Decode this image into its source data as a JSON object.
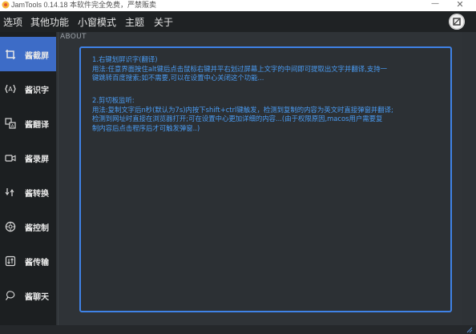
{
  "window": {
    "title": "JamTools 0.14.18 本软件完全免费，严禁贩卖",
    "minimize_glyph": "—",
    "close_glyph": "✕"
  },
  "menu": [
    "选项",
    "其他功能",
    "小窗模式",
    "主题",
    "关于"
  ],
  "sidebar": {
    "items": [
      {
        "label": "酱截屏",
        "icon": "crop-icon",
        "active": true
      },
      {
        "label": "酱识字",
        "icon": "text-recognition-icon",
        "active": false
      },
      {
        "label": "酱翻译",
        "icon": "translate-icon",
        "active": false
      },
      {
        "label": "酱录屏",
        "icon": "video-record-icon",
        "active": false
      },
      {
        "label": "酱转换",
        "icon": "convert-icon",
        "active": false
      },
      {
        "label": "酱控制",
        "icon": "control-icon",
        "active": false
      },
      {
        "label": "酱传输",
        "icon": "transfer-icon",
        "active": false
      },
      {
        "label": "酱聊天",
        "icon": "chat-icon",
        "active": false
      }
    ]
  },
  "about": {
    "section_title": "ABOUT",
    "paragraph1": [
      "1.右键划屏识字(翻译)",
      "    用法:任意界面按住alt键后点击鼠标右键并平右划过屏幕上文字的中间即可提取出文字并翻译,支持一",
      "键跳转百度搜索;如不需要,可以在设置中心关闭这个功能..."
    ],
    "paragraph2": [
      "2.剪切板监听:",
      "    用法:复制文字后n秒(默认为7s)内按下shift+ctrl键触发，检测到复制的内容为英文时直接弹窗并翻译;",
      "检测到网址时直接在浏览器打开;可在设置中心更加详细的内容...(由于权限原因,macos用户需要复",
      "制内容后点击程序后才可触发弹窗..)"
    ]
  },
  "colors": {
    "accent": "#3d6cc7",
    "about_text": "#4a9bf2",
    "about_border": "#3f82e6"
  }
}
